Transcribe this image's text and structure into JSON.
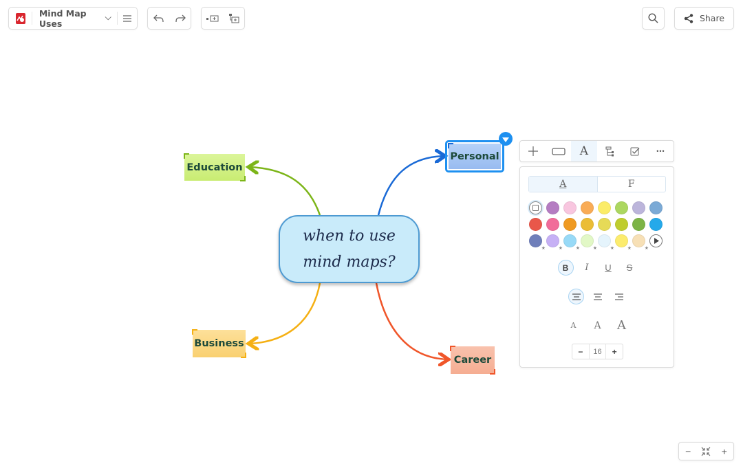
{
  "toolbar": {
    "app_logo": "mindmeister-logo",
    "doc_title": "Mind Map Uses",
    "menu_icon": "hamburger-icon",
    "undo_icon": "undo-icon",
    "redo_icon": "redo-icon",
    "add_sibling_icon": "add-sibling-icon",
    "add_child_icon": "add-child-icon",
    "search_icon": "search-icon",
    "share_label": "Share"
  },
  "map": {
    "central": {
      "line1": "when to use",
      "line2": "mind maps?",
      "fill": "#c9ebfa",
      "border": "#4d9ad2"
    },
    "nodes": [
      {
        "id": "education",
        "label": "Education",
        "fill": "#d4f28a",
        "accent": "#7cb518",
        "selected": false
      },
      {
        "id": "personal",
        "label": "Personal",
        "fill": "#a9c8f5",
        "accent": "#1a6ad6",
        "selected": true
      },
      {
        "id": "business",
        "label": "Business",
        "fill": "#fbd98a",
        "accent": "#f5b014",
        "selected": false
      },
      {
        "id": "career",
        "label": "Career",
        "fill": "#f7b8a0",
        "accent": "#f0562a",
        "selected": false
      }
    ]
  },
  "node_toolbar": {
    "items": [
      {
        "name": "add-icon",
        "glyph": "+"
      },
      {
        "name": "shape-icon",
        "glyph": ""
      },
      {
        "name": "text-format-icon",
        "glyph": "A",
        "active": true
      },
      {
        "name": "layout-icon",
        "glyph": ""
      },
      {
        "name": "task-icon",
        "glyph": ""
      },
      {
        "name": "more-icon",
        "glyph": "•••"
      }
    ]
  },
  "format_panel": {
    "tabs": [
      {
        "label": "A",
        "active": true
      },
      {
        "label": "F",
        "active": false
      }
    ],
    "colors": [
      "none",
      "#b57cc2",
      "#f8c6df",
      "#f9ac56",
      "#fbec68",
      "#acd760",
      "#bcb5db",
      "#7baad6",
      "#e9574a",
      "#f16c9a",
      "#ef9a22",
      "#ebbd35",
      "#e6da57",
      "#bfcd2e",
      "#7db446",
      "#25a9ea",
      "#6f7fba*",
      "#c6b0f5*",
      "#98daf7*",
      "#e2f8c6*",
      "#e5f4fc*",
      "#fcec6e*",
      "#f7e0b6*",
      "more"
    ],
    "style_buttons": [
      {
        "name": "bold-button",
        "label": "B",
        "active": true
      },
      {
        "name": "italic-button",
        "label": "I",
        "active": false
      },
      {
        "name": "underline-button",
        "label": "U",
        "active": false
      },
      {
        "name": "strikethrough-button",
        "label": "S",
        "active": false
      }
    ],
    "align_buttons": [
      {
        "name": "align-left-button",
        "active": true
      },
      {
        "name": "align-center-button",
        "active": false
      },
      {
        "name": "align-right-button",
        "active": false
      }
    ],
    "size_buttons": [
      {
        "name": "font-small-button",
        "label": "A"
      },
      {
        "name": "font-medium-button",
        "label": "A"
      },
      {
        "name": "font-large-button",
        "label": "A"
      }
    ],
    "font_size": {
      "minus": "−",
      "value": "16",
      "plus": "+"
    }
  },
  "zoom_controls": {
    "minus": "−",
    "fit_icon": "fit-to-screen-icon",
    "plus": "+"
  }
}
